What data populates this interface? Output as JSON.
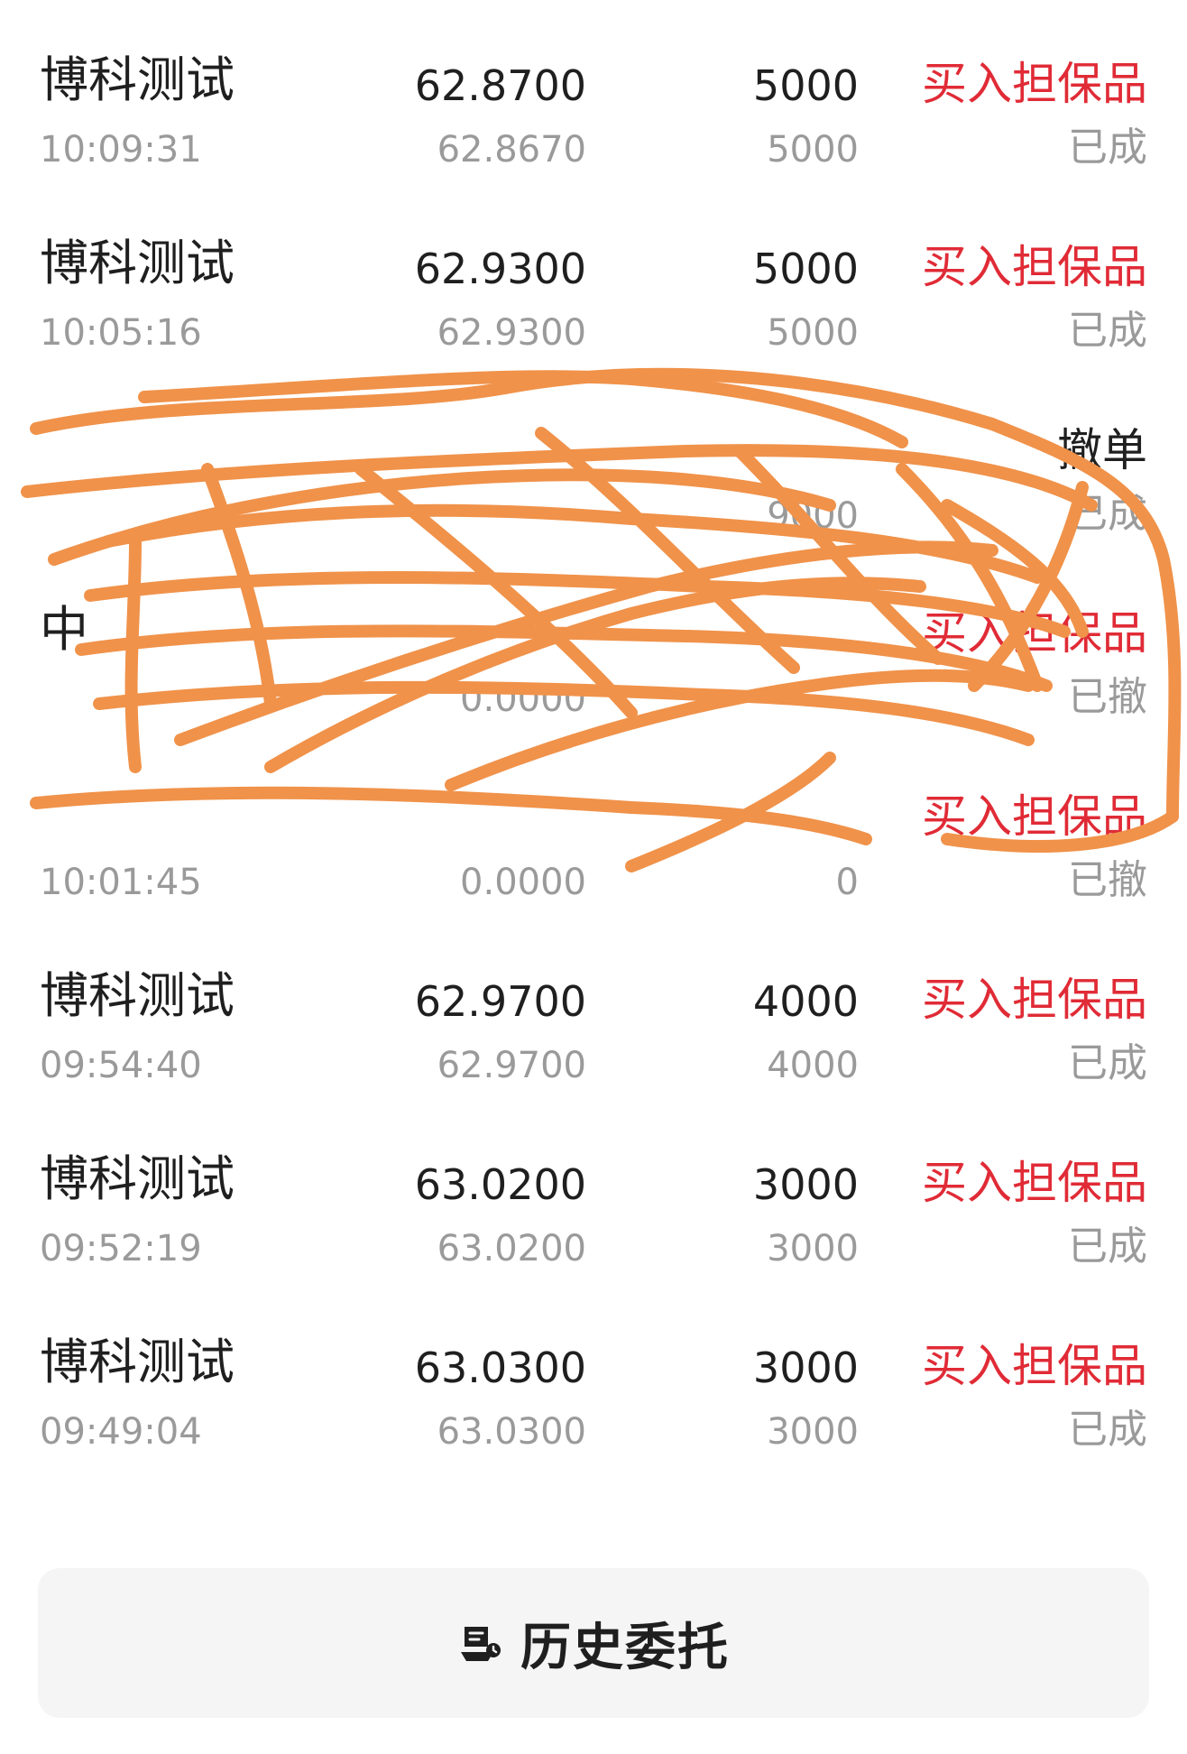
{
  "orders": [
    {
      "name": "博科测试",
      "time": "10:09:31",
      "order_price": "62.8700",
      "deal_price": "62.8670",
      "order_qty": "5000",
      "deal_qty": "5000",
      "type": "买入担保品",
      "status": "已成"
    },
    {
      "name": "博科测试",
      "time": "10:05:16",
      "order_price": "62.9300",
      "deal_price": "62.9300",
      "order_qty": "5000",
      "deal_qty": "5000",
      "type": "买入担保品",
      "status": "已成"
    },
    {
      "name": "",
      "time": "",
      "order_price": "",
      "deal_price": "",
      "order_qty": "",
      "deal_qty": "9000",
      "type": "撤单",
      "status": "已成"
    },
    {
      "name": "中",
      "time": "",
      "order_price": "",
      "deal_price": "0.0000",
      "order_qty": "",
      "deal_qty": "",
      "type": "买入担保品",
      "status": "已撤"
    },
    {
      "name": "",
      "time": "10:01:45",
      "order_price": "",
      "deal_price": "0.0000",
      "order_qty": "",
      "deal_qty": "0",
      "type": "买入担保品",
      "status": "已撤"
    },
    {
      "name": "博科测试",
      "time": "09:54:40",
      "order_price": "62.9700",
      "deal_price": "62.9700",
      "order_qty": "4000",
      "deal_qty": "4000",
      "type": "买入担保品",
      "status": "已成"
    },
    {
      "name": "博科测试",
      "time": "09:52:19",
      "order_price": "63.0200",
      "deal_price": "63.0200",
      "order_qty": "3000",
      "deal_qty": "3000",
      "type": "买入担保品",
      "status": "已成"
    },
    {
      "name": "博科测试",
      "time": "09:49:04",
      "order_price": "63.0300",
      "deal_price": "63.0300",
      "order_qty": "3000",
      "deal_qty": "3000",
      "type": "买入担保品",
      "status": "已成"
    }
  ],
  "footer": {
    "history_label": "历史委托",
    "history_icon": "history-orders-icon"
  },
  "colors": {
    "buy_red": "#e02b36",
    "muted_gray": "#9a9a9a",
    "scribble_orange": "#f0924a",
    "footer_bg": "#f5f5f5"
  }
}
